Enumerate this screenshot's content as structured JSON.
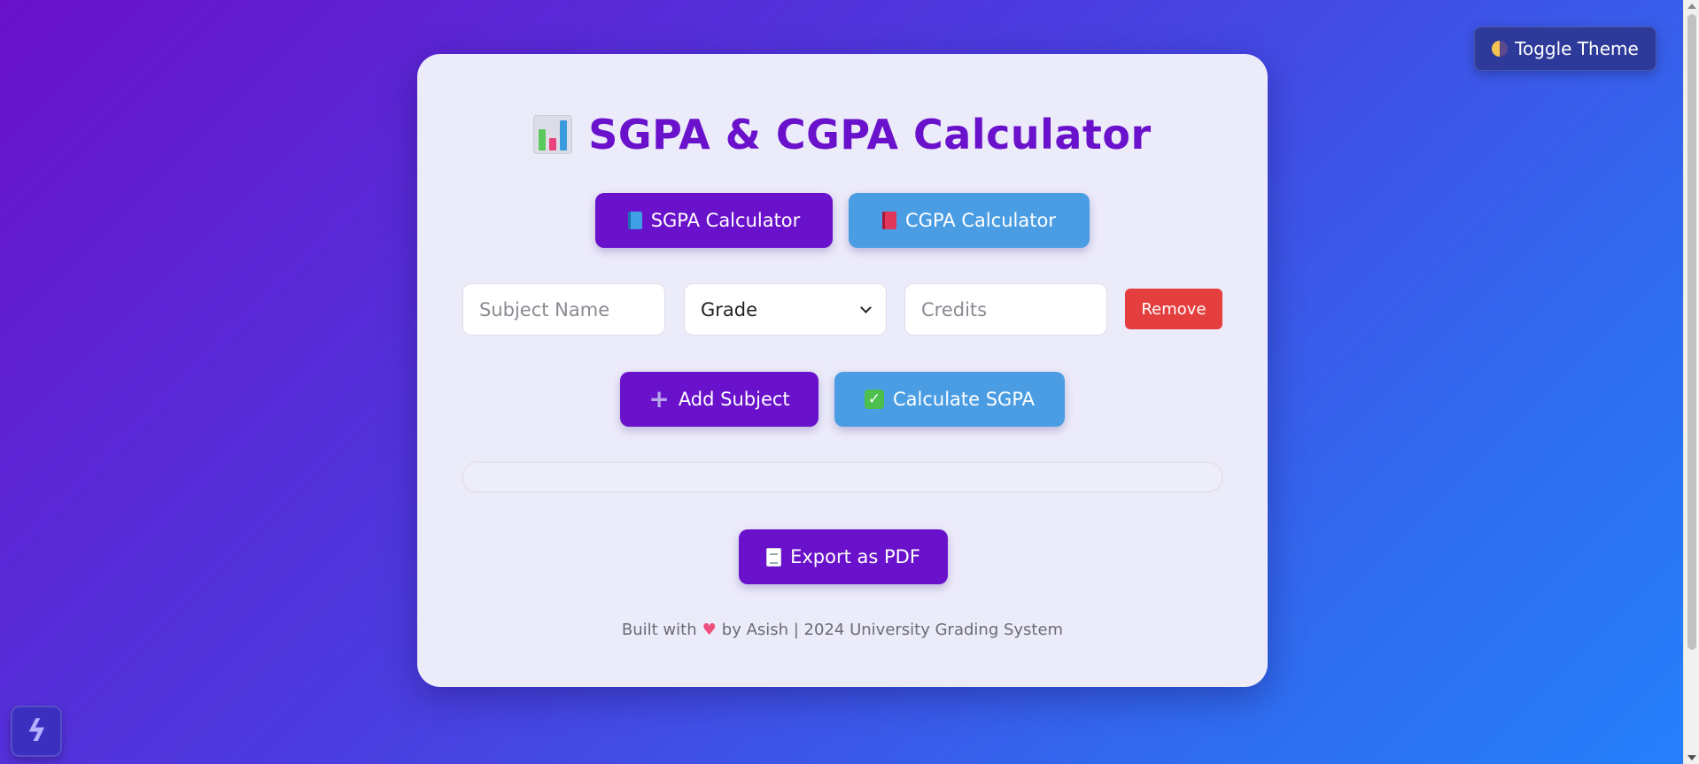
{
  "header": {
    "toggle_theme_label": "Toggle Theme"
  },
  "card": {
    "title": "SGPA & CGPA Calculator",
    "mode_tabs": [
      {
        "label": "SGPA Calculator",
        "active": true
      },
      {
        "label": "CGPA Calculator",
        "active": false
      }
    ],
    "subject_row": {
      "subject_placeholder": "Subject Name",
      "grade_selected": "Grade",
      "credits_placeholder": "Credits",
      "remove_label": "Remove"
    },
    "actions": {
      "add_subject_label": "Add Subject",
      "calculate_label": "Calculate SGPA"
    },
    "result_text": "",
    "export_label": "Export as PDF",
    "footer": {
      "built_with": "Built with",
      "by_text": "by Asish | 2024 University Grading System"
    }
  },
  "colors": {
    "primary": "#6a11cb",
    "secondary": "#4a9de3",
    "danger": "#e53e3e",
    "toggle_bg": "#2d3a9a"
  },
  "icons": [
    "half-moon-icon",
    "bar-chart-icon",
    "blue-book-icon",
    "red-book-icon",
    "plus-icon",
    "check-icon",
    "document-icon",
    "heart-icon",
    "bolt-logo-icon"
  ]
}
